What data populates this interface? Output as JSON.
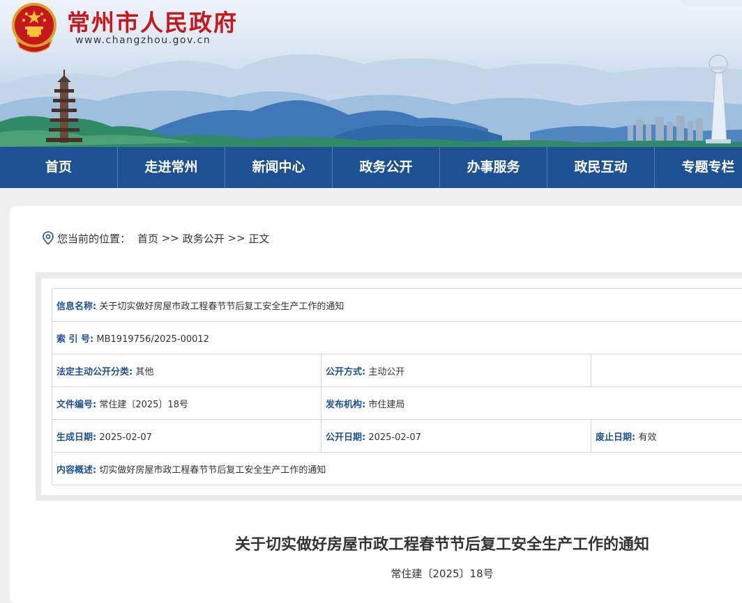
{
  "site": {
    "title": "常州市人民政府",
    "url": "www.changzhou.gov.cn"
  },
  "nav": {
    "items": [
      "首页",
      "走进常州",
      "新闻中心",
      "政务公开",
      "办事服务",
      "政民互动",
      "专题专栏"
    ]
  },
  "breadcrumb": {
    "prefix": "您当前的位置：",
    "home": "首页",
    "sep1": " >> ",
    "section": "政务公开",
    "sep2": " >> ",
    "current": "正文"
  },
  "info": {
    "name_label": "信息名称:",
    "name_value": "关于切实做好房屋市政工程春节节后复工安全生产工作的通知",
    "index_label": "索 引 号:",
    "index_value": "MB1919756/2025-00012",
    "category_label": "法定主动公开分类:",
    "category_value": "其他",
    "method_label": "公开方式:",
    "method_value": "主动公开",
    "docno_label": "文件编号:",
    "docno_value": "常住建〔2025〕18号",
    "publisher_label": "发布机构:",
    "publisher_value": "市住建局",
    "created_label": "生成日期:",
    "created_value": "2025-02-07",
    "published_label": "公开日期:",
    "published_value": "2025-02-07",
    "expire_label": "废止日期:",
    "expire_value": "有效",
    "summary_label": "内容概述:",
    "summary_value": "切实做好房屋市政工程春节节后复工安全生产工作的通知"
  },
  "article": {
    "title": "关于切实做好房屋市政工程春节节后复工安全生产工作的通知",
    "doc_number": "常住建〔2025〕18号"
  },
  "colors": {
    "brand_red": "#c8161d",
    "nav_blue": "#1d5193",
    "label_blue": "#1d5193"
  }
}
